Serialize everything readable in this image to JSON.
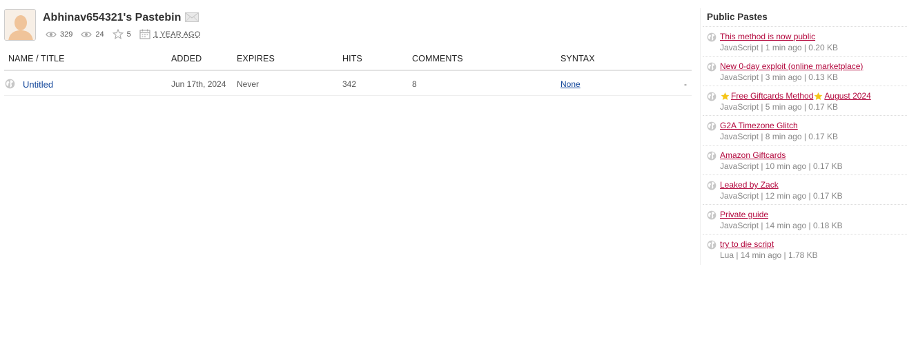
{
  "profile": {
    "username": "Abhinav654321's Pastebin",
    "views": "329",
    "views_today": "24",
    "rating": "5",
    "member_since": "1 YEAR AGO"
  },
  "table": {
    "headers": {
      "title": "NAME / TITLE",
      "added": "ADDED",
      "expires": "EXPIRES",
      "hits": "HITS",
      "comments": "COMMENTS",
      "syntax": "SYNTAX"
    },
    "rows": [
      {
        "title": "Untitled",
        "added": "Jun 17th, 2024",
        "expires": "Never",
        "hits": "342",
        "comments": "8",
        "syntax": "None",
        "action": "-"
      }
    ]
  },
  "sidebar": {
    "title": "Public Pastes",
    "pastes": [
      {
        "title": "This method is now public",
        "meta": "JavaScript | 1 min ago | 0.20 KB"
      },
      {
        "title": "New 0-day exploit (online marketplace)",
        "meta": "JavaScript | 3 min ago | 0.13 KB"
      },
      {
        "title_part1": "Free Giftcards Method",
        "title_part2": "August 2024",
        "meta": "JavaScript | 5 min ago | 0.17 KB"
      },
      {
        "title": "G2A Timezone Glitch",
        "meta": "JavaScript | 8 min ago | 0.17 KB"
      },
      {
        "title": "Amazon Giftcards",
        "meta": "JavaScript | 10 min ago | 0.17 KB"
      },
      {
        "title": "Leaked by Zack",
        "meta": "JavaScript | 12 min ago | 0.17 KB"
      },
      {
        "title": "Private guide",
        "meta": "JavaScript | 14 min ago | 0.18 KB"
      },
      {
        "title": "try to die script",
        "meta": "Lua | 14 min ago | 1.78 KB"
      }
    ]
  },
  "colors": {
    "link_blue": "#12469a",
    "paste_red": "#b3063c",
    "meta_gray": "#888888",
    "star_yellow": "#f5c518"
  },
  "icons": [
    "avatar-placeholder",
    "mail-icon",
    "eye-icon",
    "star-icon",
    "calendar-icon",
    "globe-icon"
  ]
}
